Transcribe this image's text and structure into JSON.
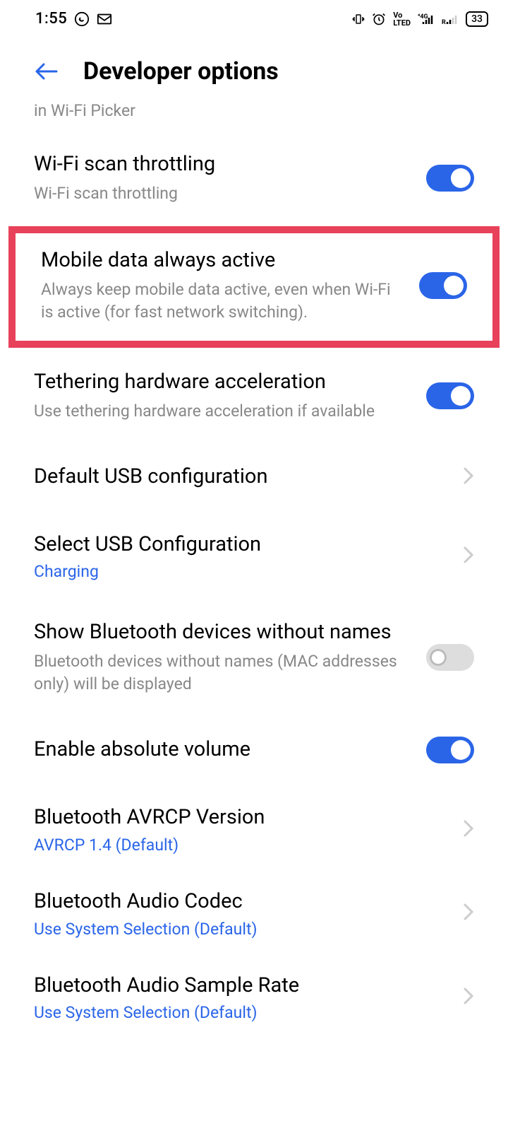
{
  "status": {
    "time": "1:55",
    "battery": "33"
  },
  "header": {
    "title": "Developer options"
  },
  "clipped": "in Wi-Fi Picker",
  "settings": {
    "wifi_throttle": {
      "title": "Wi-Fi scan throttling",
      "desc": "Wi-Fi scan throttling"
    },
    "mobile_data": {
      "title": "Mobile data always active",
      "desc": "Always keep mobile data active, even when Wi-Fi is active (for fast network switching)."
    },
    "tethering": {
      "title": "Tethering hardware acceleration",
      "desc": "Use tethering hardware acceleration if available"
    },
    "usb_default": {
      "title": "Default USB configuration"
    },
    "usb_select": {
      "title": "Select USB Configuration",
      "value": "Charging"
    },
    "bt_noname": {
      "title": "Show Bluetooth devices without names",
      "desc": "Bluetooth devices without names (MAC addresses only) will be displayed"
    },
    "abs_volume": {
      "title": "Enable absolute volume"
    },
    "avrcp": {
      "title": "Bluetooth AVRCP Version",
      "value": "AVRCP 1.4 (Default)"
    },
    "bt_codec": {
      "title": "Bluetooth Audio Codec",
      "value": "Use System Selection (Default)"
    },
    "bt_sample": {
      "title": "Bluetooth Audio Sample Rate",
      "value": "Use System Selection (Default)"
    }
  }
}
